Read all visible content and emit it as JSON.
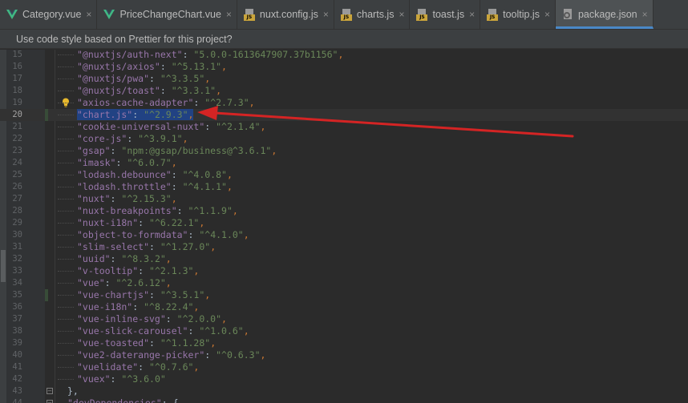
{
  "tabs": [
    {
      "label": "Category.vue",
      "icon": "vue-icon",
      "active": false
    },
    {
      "label": "PriceChangeChart.vue",
      "icon": "vue-icon",
      "active": false
    },
    {
      "label": "nuxt.config.js",
      "icon": "js-file-icon",
      "active": false
    },
    {
      "label": "charts.js",
      "icon": "js-file-icon",
      "active": false
    },
    {
      "label": "toast.js",
      "icon": "js-file-icon",
      "active": false
    },
    {
      "label": "tooltip.js",
      "icon": "js-file-icon",
      "active": false
    },
    {
      "label": "package.json",
      "icon": "json-file-icon",
      "active": true
    }
  ],
  "close_glyph": "×",
  "js_badge": "JS",
  "banner": {
    "text": "Use code style based on Prettier for this project?"
  },
  "gutter_icons": {
    "fold_open": "−"
  },
  "editor": {
    "current_line": 20,
    "selected_line": 20,
    "lines": [
      {
        "n": "15",
        "key": "\"@nuxtjs/auth-next\"",
        "val": "\"5.0.0-1613647907.37b1156\"",
        "comma": ","
      },
      {
        "n": "16",
        "key": "\"@nuxtjs/axios\"",
        "val": "\"^5.13.1\"",
        "comma": ","
      },
      {
        "n": "17",
        "key": "\"@nuxtjs/pwa\"",
        "val": "\"^3.3.5\"",
        "comma": ","
      },
      {
        "n": "18",
        "key": "\"@nuxtjs/toast\"",
        "val": "\"^3.3.1\"",
        "comma": ","
      },
      {
        "n": "19",
        "key": "\"axios-cache-adapter\"",
        "val": "\"^2.7.3\"",
        "comma": ","
      },
      {
        "n": "20",
        "key": "\"chart.js\"",
        "val": "\"^2.9.3\"",
        "comma": ","
      },
      {
        "n": "21",
        "key": "\"cookie-universal-nuxt\"",
        "val": "\"^2.1.4\"",
        "comma": ","
      },
      {
        "n": "22",
        "key": "\"core-js\"",
        "val": "\"^3.9.1\"",
        "comma": ","
      },
      {
        "n": "23",
        "key": "\"gsap\"",
        "val": "\"npm:@gsap/business@^3.6.1\"",
        "comma": ","
      },
      {
        "n": "24",
        "key": "\"imask\"",
        "val": "\"^6.0.7\"",
        "comma": ","
      },
      {
        "n": "25",
        "key": "\"lodash.debounce\"",
        "val": "\"^4.0.8\"",
        "comma": ","
      },
      {
        "n": "26",
        "key": "\"lodash.throttle\"",
        "val": "\"^4.1.1\"",
        "comma": ","
      },
      {
        "n": "27",
        "key": "\"nuxt\"",
        "val": "\"^2.15.3\"",
        "comma": ","
      },
      {
        "n": "28",
        "key": "\"nuxt-breakpoints\"",
        "val": "\"^1.1.9\"",
        "comma": ","
      },
      {
        "n": "29",
        "key": "\"nuxt-i18n\"",
        "val": "\"^6.22.1\"",
        "comma": ","
      },
      {
        "n": "30",
        "key": "\"object-to-formdata\"",
        "val": "\"^4.1.0\"",
        "comma": ","
      },
      {
        "n": "31",
        "key": "\"slim-select\"",
        "val": "\"^1.27.0\"",
        "comma": ","
      },
      {
        "n": "32",
        "key": "\"uuid\"",
        "val": "\"^8.3.2\"",
        "comma": ","
      },
      {
        "n": "33",
        "key": "\"v-tooltip\"",
        "val": "\"^2.1.3\"",
        "comma": ","
      },
      {
        "n": "34",
        "key": "\"vue\"",
        "val": "\"^2.6.12\"",
        "comma": ","
      },
      {
        "n": "35",
        "key": "\"vue-chartjs\"",
        "val": "\"^3.5.1\"",
        "comma": ","
      },
      {
        "n": "36",
        "key": "\"vue-i18n\"",
        "val": "\"^8.22.4\"",
        "comma": ","
      },
      {
        "n": "37",
        "key": "\"vue-inline-svg\"",
        "val": "\"^2.0.0\"",
        "comma": ","
      },
      {
        "n": "38",
        "key": "\"vue-slick-carousel\"",
        "val": "\"^1.0.6\"",
        "comma": ","
      },
      {
        "n": "39",
        "key": "\"vue-toasted\"",
        "val": "\"^1.1.28\"",
        "comma": ","
      },
      {
        "n": "40",
        "key": "\"vue2-daterange-picker\"",
        "val": "\"^0.6.3\"",
        "comma": ","
      },
      {
        "n": "41",
        "key": "\"vuelidate\"",
        "val": "\"^0.7.6\"",
        "comma": ","
      },
      {
        "n": "42",
        "key": "\"vuex\"",
        "val": "\"^3.6.0\"",
        "comma": ""
      },
      {
        "n": "43",
        "raw": "},"
      },
      {
        "n": "44",
        "key": "\"devDependencies\"",
        "val": "{",
        "comma": "",
        "outer": true
      }
    ]
  },
  "colors": {
    "annotation_arrow": "#d42424",
    "key": "#9876aa",
    "string": "#6a8759",
    "selection": "#214283",
    "tab_active_underline": "#4a88c7"
  }
}
